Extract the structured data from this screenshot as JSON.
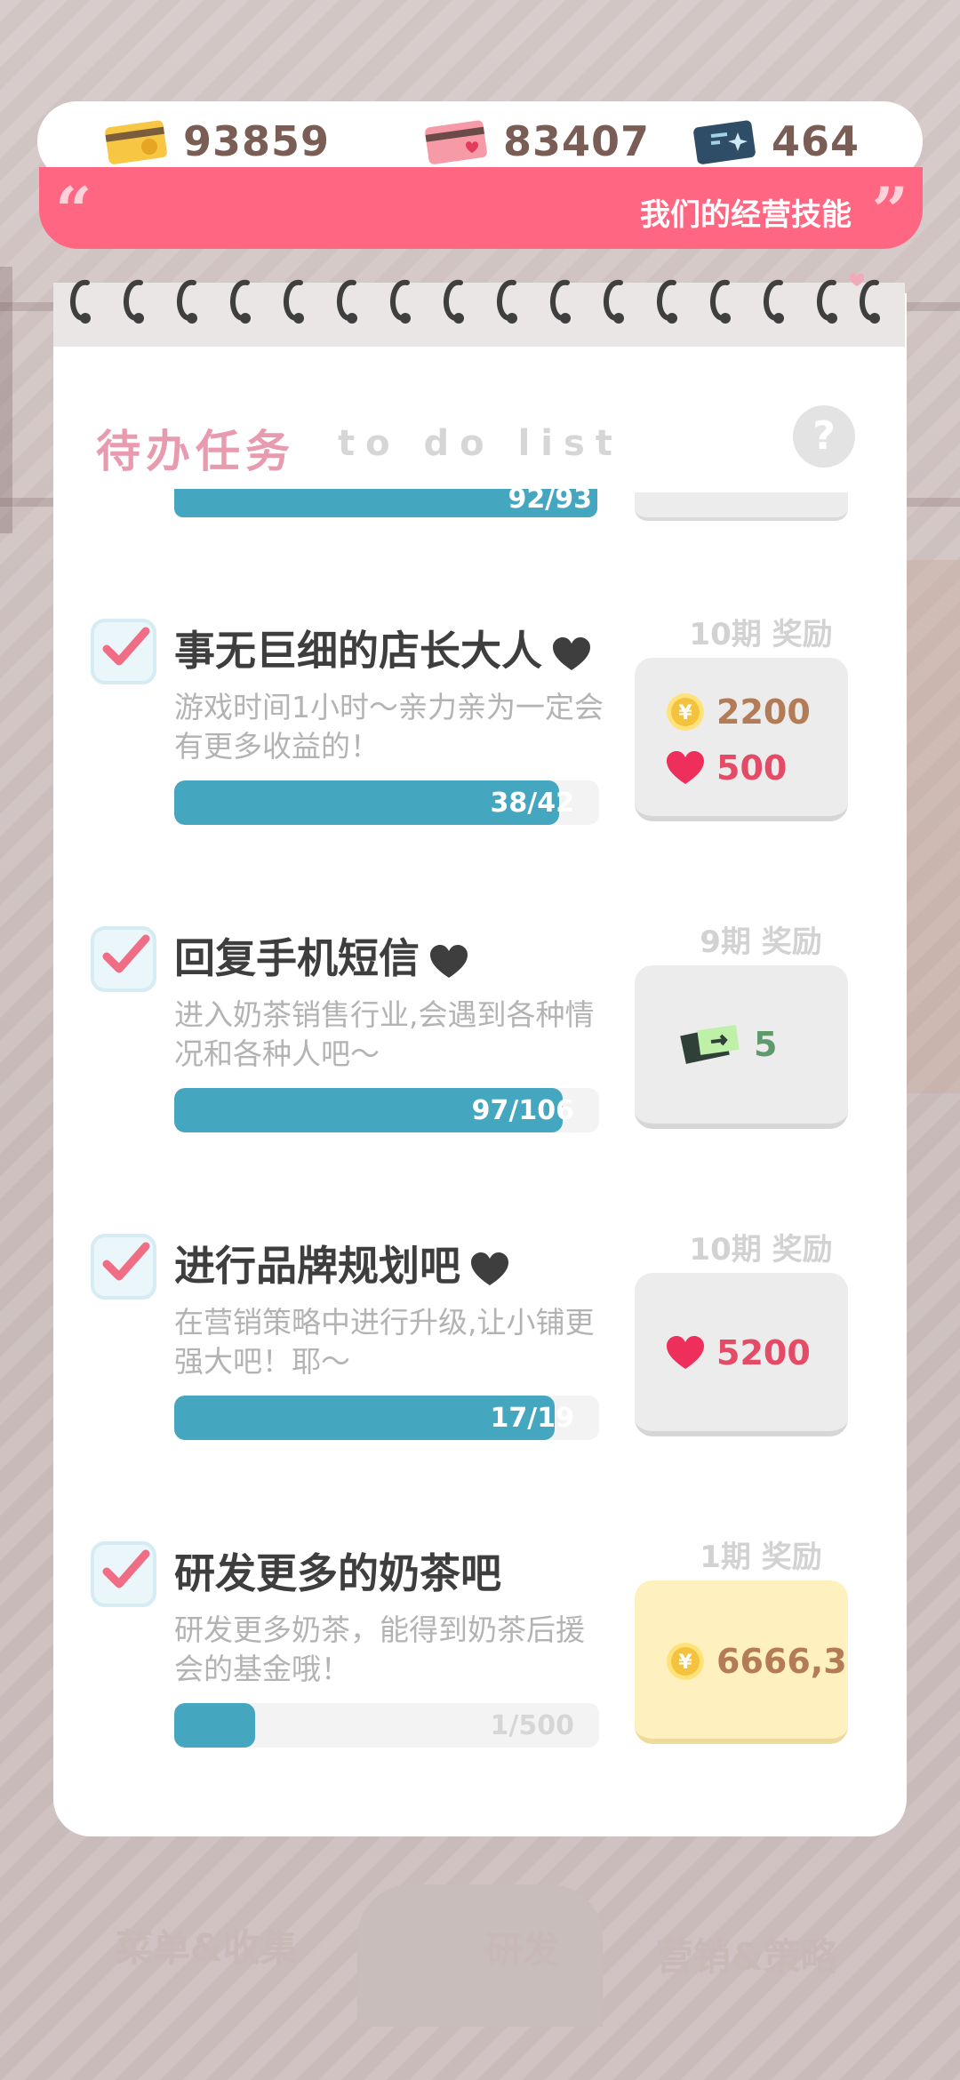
{
  "currencies": [
    {
      "name": "gold-card",
      "value": "93859",
      "color": "#f7c744"
    },
    {
      "name": "heart-card",
      "value": "83407",
      "color": "#f59aa6"
    },
    {
      "name": "ticket-card",
      "value": "464",
      "color": "#2f4d66"
    }
  ],
  "banner": {
    "text": "我们的经营技能"
  },
  "todo": {
    "title": "待办任务",
    "subtitle": "to do list",
    "help": "?"
  },
  "partial_item": {
    "progress_text": "92/93"
  },
  "tasks": [
    {
      "title": "事无巨细的店长大人",
      "desc": "游戏时间1小时～亲力亲为一定会有更多收益的！",
      "progress_text": "38/42",
      "progress": 0.905,
      "reward_label": "10期 奖励",
      "rewards": [
        {
          "type": "coin",
          "value": "2200"
        },
        {
          "type": "heart",
          "value": "500"
        }
      ]
    },
    {
      "title": "回复手机短信",
      "desc": "进入奶茶销售行业,会遇到各种情况和各种人吧～",
      "progress_text": "97/106",
      "progress": 0.915,
      "reward_label": "9期 奖励",
      "rewards": [
        {
          "type": "ticket",
          "value": "5"
        }
      ]
    },
    {
      "title": "进行品牌规划吧",
      "desc": "在营销策略中进行升级,让小铺更强大吧！耶～",
      "progress_text": "17/19",
      "progress": 0.895,
      "reward_label": "10期 奖励",
      "rewards": [
        {
          "type": "heart",
          "value": "5200"
        }
      ]
    },
    {
      "title": "研发更多的奶茶吧",
      "desc": "研发更多奶茶，能得到奶茶后援会的基金哦！",
      "progress_text": "1/500",
      "progress": 0.19,
      "reward_label": "1期 奖励",
      "rewards": [
        {
          "type": "coin",
          "value": "6666,3"
        }
      ]
    }
  ],
  "nav": {
    "menu": "菜单&收集",
    "research": "研发",
    "marketing": "营销&策略"
  }
}
